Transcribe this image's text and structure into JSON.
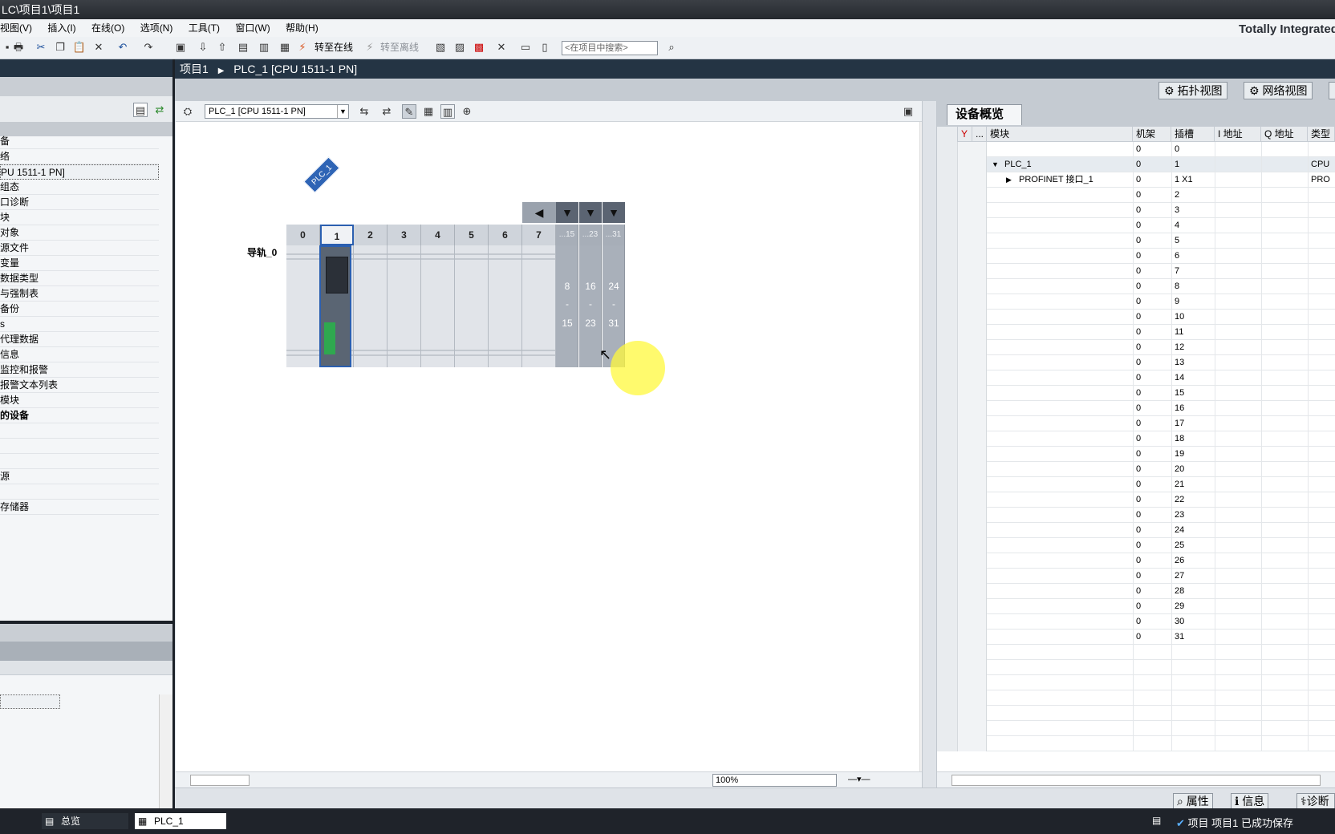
{
  "window": {
    "title": "LC\\项目1\\项目1",
    "brand": "Totally Integrated"
  },
  "menu": [
    "视图(V)",
    "插入(I)",
    "在线(O)",
    "选项(N)",
    "工具(T)",
    "窗口(W)",
    "帮助(H)"
  ],
  "toolbar": {
    "go_online": "转至在线",
    "go_offline": "转至离线",
    "search_placeholder": "<在项目中搜索>"
  },
  "breadcrumb": {
    "project": "项目1",
    "device": "PLC_1 [CPU 1511-1 PN]"
  },
  "views": {
    "topology": "拓扑视图",
    "network": "网络视图"
  },
  "tree": [
    "备",
    "络",
    "PU 1511-1 PN]",
    "组态",
    "口诊断",
    "块",
    "对象",
    "源文件",
    "变量",
    "数据类型",
    "与强制表",
    "备份",
    "s",
    "代理数据",
    "信息",
    "监控和报警",
    "报警文本列表",
    "模块",
    "的设备",
    "",
    "",
    "",
    "源",
    "",
    "存储器"
  ],
  "editor": {
    "device_select": "PLC_1 [CPU 1511-1 PN]",
    "zoom": "100%",
    "plc_tag": "PLC_1",
    "rail": "导轨_0",
    "slots": [
      "0",
      "1",
      "2",
      "3",
      "4",
      "5",
      "6",
      "7"
    ],
    "ext_slots": [
      {
        "head": "...15",
        "from": "8",
        "to": "15"
      },
      {
        "head": "...23",
        "from": "16",
        "to": "23"
      },
      {
        "head": "...31",
        "from": "24",
        "to": "31"
      }
    ]
  },
  "overview": {
    "tab": "设备概览",
    "columns": [
      "...",
      "模块",
      "机架",
      "插槽",
      "I 地址",
      "Q 地址",
      "类型"
    ],
    "rows": [
      {
        "module": "",
        "rack": "0",
        "slot": "0",
        "type": ""
      },
      {
        "module": "PLC_1",
        "rack": "0",
        "slot": "1",
        "type": "CPU"
      },
      {
        "module": "PROFINET 接口_1",
        "rack": "0",
        "slot": "1 X1",
        "type": "PRO"
      },
      {
        "module": "",
        "rack": "0",
        "slot": "2",
        "type": ""
      },
      {
        "module": "",
        "rack": "0",
        "slot": "3",
        "type": ""
      },
      {
        "module": "",
        "rack": "0",
        "slot": "4",
        "type": ""
      },
      {
        "module": "",
        "rack": "0",
        "slot": "5",
        "type": ""
      },
      {
        "module": "",
        "rack": "0",
        "slot": "6",
        "type": ""
      },
      {
        "module": "",
        "rack": "0",
        "slot": "7",
        "type": ""
      },
      {
        "module": "",
        "rack": "0",
        "slot": "8",
        "type": ""
      },
      {
        "module": "",
        "rack": "0",
        "slot": "9",
        "type": ""
      },
      {
        "module": "",
        "rack": "0",
        "slot": "10",
        "type": ""
      },
      {
        "module": "",
        "rack": "0",
        "slot": "11",
        "type": ""
      },
      {
        "module": "",
        "rack": "0",
        "slot": "12",
        "type": ""
      },
      {
        "module": "",
        "rack": "0",
        "slot": "13",
        "type": ""
      },
      {
        "module": "",
        "rack": "0",
        "slot": "14",
        "type": ""
      },
      {
        "module": "",
        "rack": "0",
        "slot": "15",
        "type": ""
      },
      {
        "module": "",
        "rack": "0",
        "slot": "16",
        "type": ""
      },
      {
        "module": "",
        "rack": "0",
        "slot": "17",
        "type": ""
      },
      {
        "module": "",
        "rack": "0",
        "slot": "18",
        "type": ""
      },
      {
        "module": "",
        "rack": "0",
        "slot": "19",
        "type": ""
      },
      {
        "module": "",
        "rack": "0",
        "slot": "20",
        "type": ""
      },
      {
        "module": "",
        "rack": "0",
        "slot": "21",
        "type": ""
      },
      {
        "module": "",
        "rack": "0",
        "slot": "22",
        "type": ""
      },
      {
        "module": "",
        "rack": "0",
        "slot": "23",
        "type": ""
      },
      {
        "module": "",
        "rack": "0",
        "slot": "24",
        "type": ""
      },
      {
        "module": "",
        "rack": "0",
        "slot": "25",
        "type": ""
      },
      {
        "module": "",
        "rack": "0",
        "slot": "26",
        "type": ""
      },
      {
        "module": "",
        "rack": "0",
        "slot": "27",
        "type": ""
      },
      {
        "module": "",
        "rack": "0",
        "slot": "28",
        "type": ""
      },
      {
        "module": "",
        "rack": "0",
        "slot": "29",
        "type": ""
      },
      {
        "module": "",
        "rack": "0",
        "slot": "30",
        "type": ""
      },
      {
        "module": "",
        "rack": "0",
        "slot": "31",
        "type": ""
      }
    ]
  },
  "bottom_tabs": {
    "properties": "属性",
    "info": "信息",
    "diagnostics": "诊断"
  },
  "taskbar": {
    "portal": "总览",
    "plc": "PLC_1",
    "status": "项目 项目1 已成功保存"
  }
}
